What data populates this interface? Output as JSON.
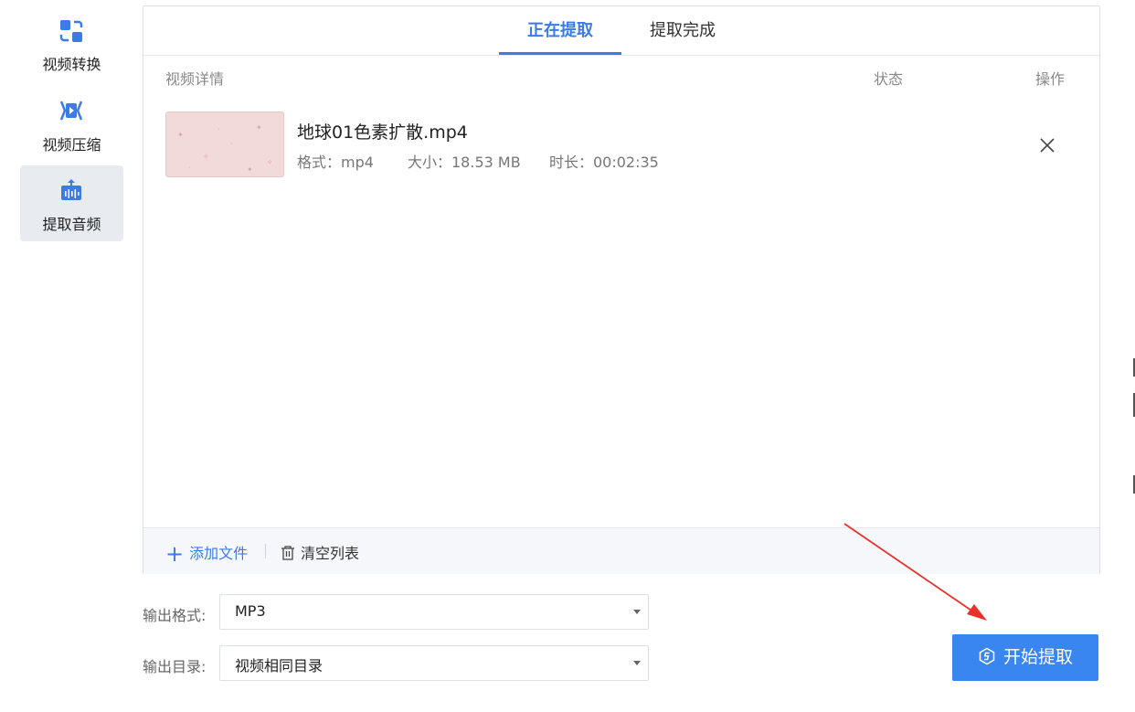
{
  "sidebar": {
    "items": [
      {
        "label": "视频转换",
        "icon": "convert-icon"
      },
      {
        "label": "视频压缩",
        "icon": "compress-icon"
      },
      {
        "label": "提取音频",
        "icon": "audio-extract-icon",
        "active": true
      }
    ]
  },
  "tabs": {
    "extracting": "正在提取",
    "completed": "提取完成"
  },
  "columns": {
    "details": "视频详情",
    "status": "状态",
    "action": "操作"
  },
  "files": [
    {
      "name": "地球01色素扩散.mp4",
      "format": "格式：mp4",
      "size": "大小：18.53 MB",
      "duration": "时长：00:02:35"
    }
  ],
  "footer": {
    "add_file": "添加文件",
    "clear_list": "清空列表"
  },
  "output": {
    "format_label": "输出格式:",
    "format_value": "MP3",
    "dir_label": "输出目录:",
    "dir_value": "视频相同目录"
  },
  "start_button": "开始提取",
  "colors": {
    "accent": "#3a7be8",
    "button": "#3a86f0",
    "arrow": "#e8312a"
  }
}
